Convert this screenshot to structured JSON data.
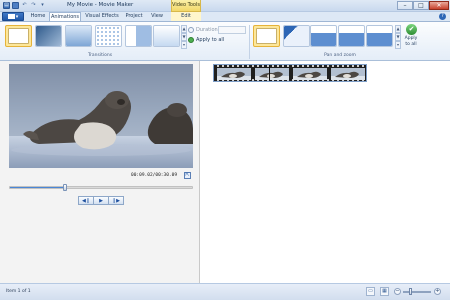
{
  "window": {
    "title": "My Movie - Movie Maker",
    "contextual_group": "Video Tools",
    "minimize": "–",
    "maximize": "□",
    "close": "✕"
  },
  "quick_access": [
    "save-icon",
    "undo-icon",
    "redo-icon",
    "dropdown-icon"
  ],
  "ribbon_tabs": [
    {
      "label": "Home",
      "active": false
    },
    {
      "label": "Animations",
      "active": true
    },
    {
      "label": "Visual Effects",
      "active": false
    },
    {
      "label": "Project",
      "active": false
    },
    {
      "label": "View",
      "active": false
    },
    {
      "label": "Edit",
      "active": false,
      "contextual": true
    }
  ],
  "help_label": "?",
  "transitions": {
    "group_label": "Transitions",
    "items": [
      "none",
      "crossfade",
      "blur",
      "dissolve",
      "slide",
      "zoom"
    ],
    "selected_index": 0,
    "duration_label": "Duration:",
    "duration_value": "",
    "apply_to_all_label": "Apply to all"
  },
  "pan_zoom": {
    "group_label": "Pan and zoom",
    "items": [
      "none",
      "pan-diagonal",
      "zoom-in",
      "zoom-out",
      "pan-up"
    ],
    "selected_index": 0,
    "apply_to_all_label": "Apply to all"
  },
  "gallery_scroll": {
    "up": "▲",
    "down": "▼",
    "more": "▾"
  },
  "preview": {
    "timecode": "00:09.02/00:30.09",
    "fullscreen": "⇱",
    "seek_progress": 0.3,
    "prev_frame": "◀❙",
    "play": "▶",
    "next_frame": "❙▶"
  },
  "storyboard": {
    "clip_frames": 4,
    "playhead_position": 0.36
  },
  "status": {
    "text": "Item 1 of 1",
    "zoom_minus": "−",
    "zoom_plus": "+",
    "zoom_level": 0.25
  },
  "colors": {
    "accent": "#2e67b6",
    "selection": "#fde79a",
    "contextual_tab": "#f2d86a"
  }
}
